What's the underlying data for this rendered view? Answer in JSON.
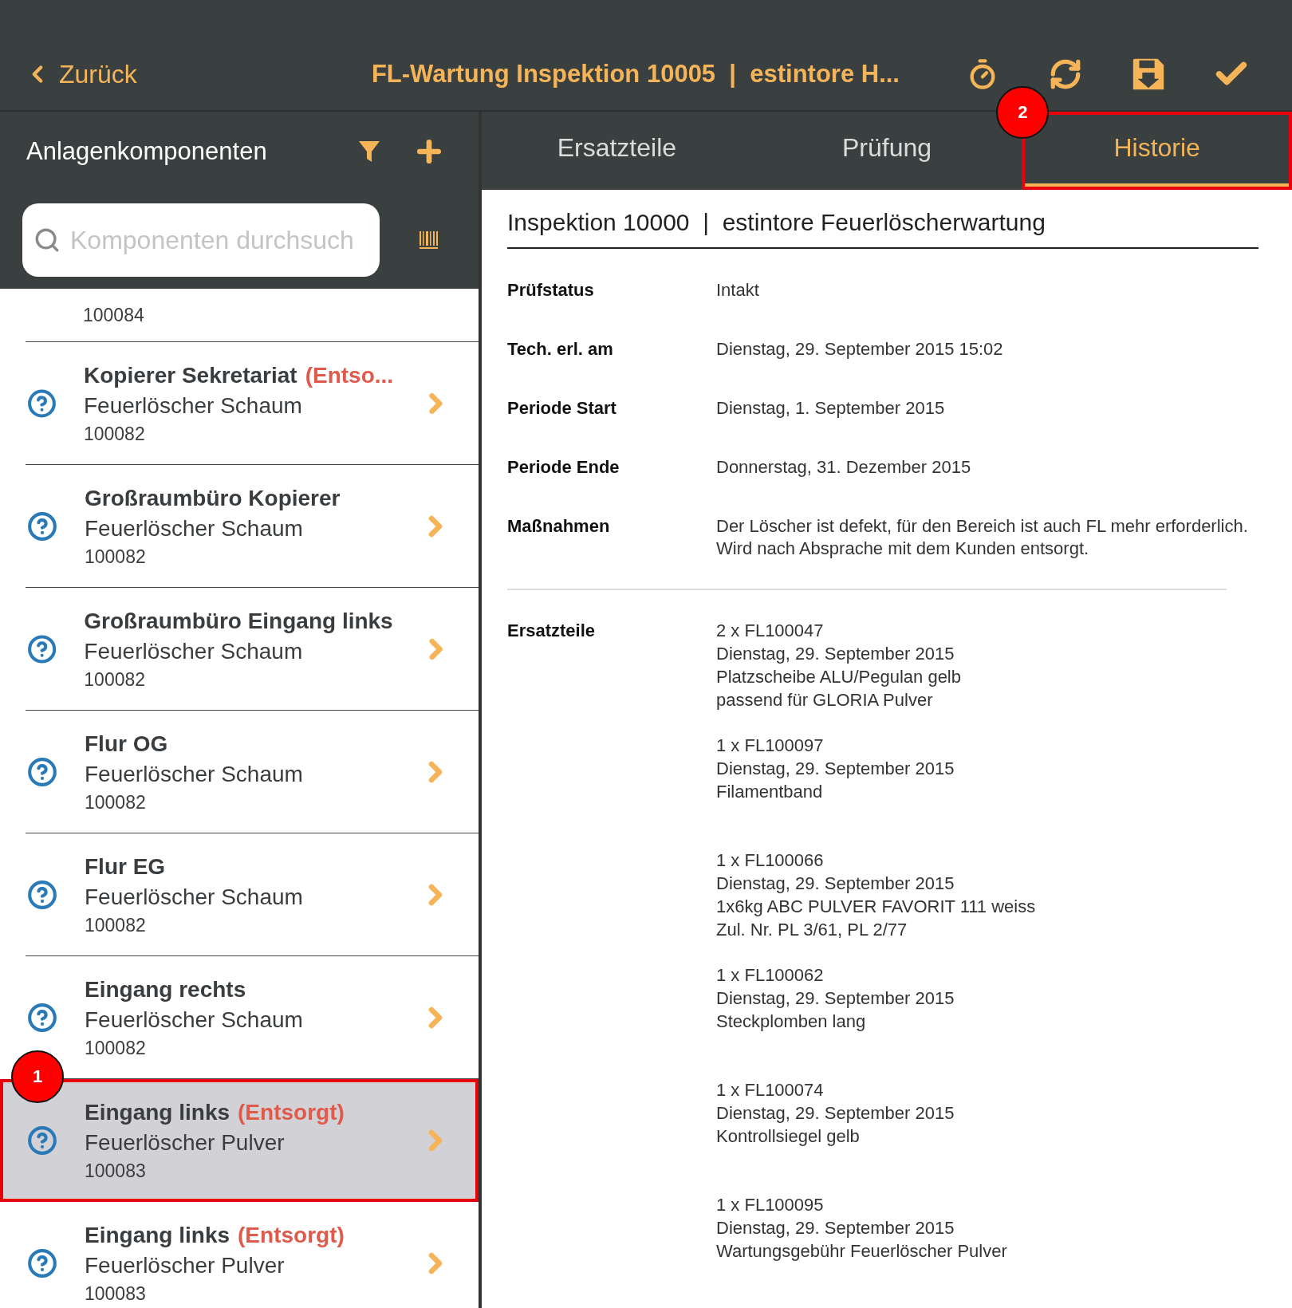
{
  "nav": {
    "back": "Zurück",
    "title": "FL-Wartung Inspektion 10005  |  estintore H..."
  },
  "sidebar": {
    "title": "Anlagenkomponenten",
    "search": {
      "placeholder": "Komponenten durchsuch"
    },
    "items": [
      {
        "kind": "partial",
        "number": "100084",
        "selected": false
      },
      {
        "kind": "full",
        "title": "Kopierer Sekretariat",
        "status": "(Entso...",
        "type": "Feuerlöscher Schaum",
        "number": "100082",
        "selected": false
      },
      {
        "kind": "full",
        "title": "Großraumbüro Kopierer",
        "type": "Feuerlöscher Schaum",
        "number": "100082",
        "selected": false
      },
      {
        "kind": "full",
        "title": "Großraumbüro Eingang links",
        "type": "Feuerlöscher Schaum",
        "number": "100082",
        "selected": false
      },
      {
        "kind": "full",
        "title": "Flur OG",
        "type": "Feuerlöscher Schaum",
        "number": "100082",
        "selected": false
      },
      {
        "kind": "full",
        "title": "Flur EG",
        "type": "Feuerlöscher Schaum",
        "number": "100082",
        "selected": false
      },
      {
        "kind": "full",
        "title": "Eingang rechts",
        "type": "Feuerlöscher Schaum",
        "number": "100082",
        "selected": false
      },
      {
        "kind": "full",
        "title": "Eingang links",
        "status": "(Entsorgt)",
        "type": "Feuerlöscher Pulver",
        "number": "100083",
        "selected": true,
        "callout": "1"
      },
      {
        "kind": "full",
        "title": "Eingang links",
        "status": "(Entsorgt)",
        "type": "Feuerlöscher Pulver",
        "number": "100083",
        "selected": false
      }
    ]
  },
  "tabs": [
    {
      "label": "Ersatzteile",
      "selected": false
    },
    {
      "label": "Prüfung",
      "selected": false
    },
    {
      "label": "Historie",
      "selected": true,
      "callout": "2"
    }
  ],
  "detail": {
    "heading": "Inspektion 10000  |  estintore Feuerlöscherwartung",
    "fields": [
      {
        "label": "Prüfstatus",
        "value": "Intakt"
      },
      {
        "label": "Tech. erl. am",
        "value": "Dienstag, 29. September 2015 15:02"
      },
      {
        "label": "Periode Start",
        "value": "Dienstag, 1. September 2015"
      },
      {
        "label": "Periode Ende",
        "value": "Donnerstag, 31. Dezember 2015"
      },
      {
        "label": "Maßnahmen",
        "value": "Der Löscher ist defekt, für den Bereich ist auch FL mehr erforderlich. Wird nach Absprache mit dem Kunden entsorgt."
      }
    ],
    "parts_label": "Ersatzteile",
    "parts": [
      {
        "lines": [
          "2 x FL100047",
          "Dienstag, 29. September 2015",
          "Platzscheibe ALU/Pegulan gelb",
          "passend für GLORIA Pulver"
        ]
      },
      {
        "lines": [
          "1 x FL100097",
          "Dienstag, 29. September 2015",
          "Filamentband"
        ]
      },
      {
        "lines": [
          "1 x FL100066",
          "Dienstag, 29. September 2015",
          "1x6kg ABC PULVER FAVORIT 111 weiss",
          "Zul. Nr. PL 3/61, PL 2/77"
        ]
      },
      {
        "lines": [
          "1 x FL100062",
          "Dienstag, 29. September 2015",
          "Steckplomben lang"
        ]
      },
      {
        "lines": [
          "1 x FL100074",
          "Dienstag, 29. September 2015",
          "Kontrollsiegel gelb"
        ]
      },
      {
        "lines": [
          "1 x FL100095",
          "Dienstag, 29. September 2015",
          "Wartungsgebühr Feuerlöscher Pulver"
        ]
      }
    ]
  }
}
